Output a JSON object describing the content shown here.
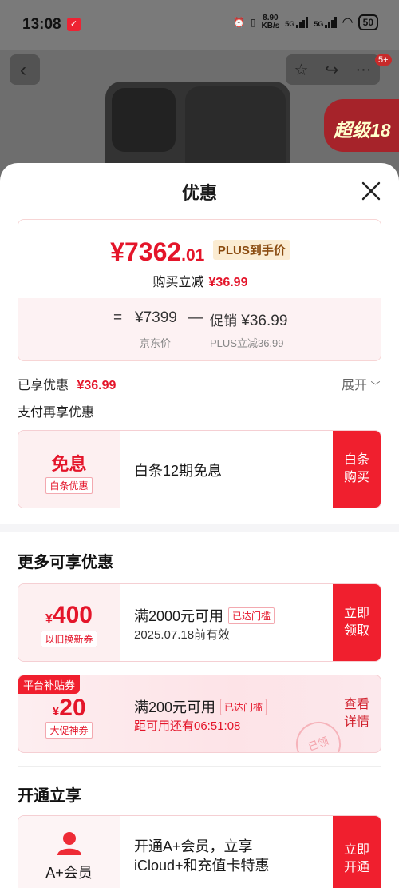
{
  "status": {
    "time": "13:08",
    "net_speed": "8.90",
    "net_unit": "KB/s",
    "net1": "5G",
    "net2": "5G",
    "battery": "50"
  },
  "nav": {
    "badge": "5+",
    "promo": "超级18"
  },
  "sheet": {
    "title": "优惠"
  },
  "summary": {
    "price_main": "¥7362",
    "price_decimal": ".01",
    "plus_tag": "PLUS到手价",
    "reduce_label": "购买立减",
    "reduce_amount": "¥36.99",
    "eq": "=",
    "jd_price": "¥7399",
    "minus": "—",
    "promo_label": "促销",
    "promo_amount": "¥36.99",
    "jd_price_caption": "京东价",
    "plus_caption": "PLUS立减36.99"
  },
  "enjoyed": {
    "label": "已享优惠",
    "amount": "¥36.99",
    "expand": "展开"
  },
  "pay_more": {
    "label": "支付再享优惠"
  },
  "baitiao": {
    "title": "免息",
    "tag": "白条优惠",
    "desc": "白条12期免息",
    "action": "白条购买"
  },
  "more_section": {
    "title": "更多可享优惠"
  },
  "coupon1": {
    "currency": "¥",
    "value": "400",
    "tag": "以旧换新券",
    "title": "满2000元可用",
    "threshold": "已达门槛",
    "sub": "2025.07.18前有效",
    "action": "立即领取"
  },
  "coupon2": {
    "corner": "平台补贴券",
    "currency": "¥",
    "value": "20",
    "tag": "大促神券",
    "title": "满200元可用",
    "threshold": "已达门槛",
    "sub": "距可用还有06:51:08",
    "action": "查看详情",
    "stamp": "已领"
  },
  "open_section": {
    "title": "开通立享"
  },
  "member": {
    "name": "A+会员",
    "desc_line1": "开通A+会员，立享",
    "desc_line2": "iCloud+和充值卡特惠",
    "action": "立即开通"
  }
}
